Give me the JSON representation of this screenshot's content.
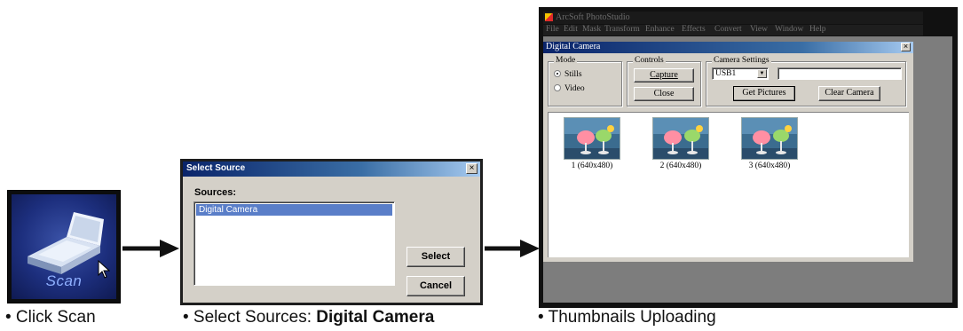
{
  "scan_icon": {
    "label": "Scan"
  },
  "select_source_dialog": {
    "title": "Select Source",
    "close_glyph": "×",
    "sources_label": "Sources:",
    "sources": [
      "Digital Camera"
    ],
    "select_button": "Select",
    "cancel_button": "Cancel"
  },
  "photostudio": {
    "app_title": "ArcSoft PhotoStudio",
    "menu": [
      "File",
      "Edit",
      "Mask",
      "Transform",
      "Enhance",
      "Effects",
      "Convert",
      "View",
      "Window",
      "Help"
    ],
    "digital_camera_window": {
      "title": "Digital Camera",
      "close_glyph": "×",
      "mode_group": {
        "label": "Mode",
        "options": [
          "Stills",
          "Video"
        ],
        "selected": "Stills"
      },
      "controls_group": {
        "label": "Controls",
        "capture_button": "Capture",
        "close_button": "Close"
      },
      "camera_settings_group": {
        "label": "Camera Settings",
        "port_value": "USB1",
        "name_value": "",
        "get_pictures_button": "Get Pictures",
        "clear_camera_button": "Clear Camera"
      },
      "thumbnails": [
        {
          "caption": "1 (640x480)"
        },
        {
          "caption": "2 (640x480)"
        },
        {
          "caption": "3 (640x480)"
        }
      ]
    }
  },
  "captions": {
    "step1": "• Click Scan",
    "step2_prefix": "• Select Sources: ",
    "step2_bold": "Digital Camera",
    "step3": "• Thumbnails Uploading"
  },
  "colors": {
    "titlebar_active": "#0a246a",
    "list_selection": "#5a7ec8",
    "dialog_face": "#d4d0c8",
    "scan_tile_blue": "#1d2f7e"
  },
  "icons": [
    "scanner-icon",
    "cursor-arrow-icon",
    "close-icon",
    "radio-icon",
    "dropdown-arrow-icon",
    "photostudio-app-icon",
    "arrow-right-icon"
  ]
}
